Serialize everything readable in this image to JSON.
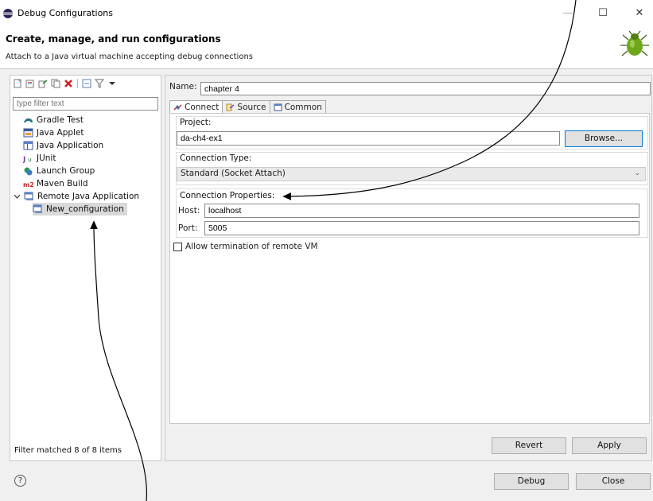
{
  "window": {
    "title": "Debug Configurations",
    "minimize_label": "—",
    "maximize_label": "☐",
    "close_label": "✕"
  },
  "header": {
    "title": "Create, manage, and run configurations",
    "subtitle": "Attach to a Java virtual machine accepting debug connections"
  },
  "left_panel": {
    "filter_placeholder": "type filter text",
    "tree": [
      {
        "label": "Gradle Test",
        "icon": "gradle-icon"
      },
      {
        "label": "Java Applet",
        "icon": "java-applet-icon"
      },
      {
        "label": "Java Application",
        "icon": "java-application-icon"
      },
      {
        "label": "JUnit",
        "icon": "junit-icon"
      },
      {
        "label": "Launch Group",
        "icon": "launch-group-icon"
      },
      {
        "label": "Maven Build",
        "icon": "maven-icon"
      },
      {
        "label": "Remote Java Application",
        "icon": "remote-java-icon",
        "expanded": true
      },
      {
        "label": "New_configuration",
        "icon": "remote-java-icon",
        "selected": true
      }
    ],
    "status": "Filter matched 8 of 8 items"
  },
  "config": {
    "name_label": "Name:",
    "name_value": "chapter 4",
    "tabs": [
      {
        "label": "Connect",
        "icon": "connect-icon",
        "active": true
      },
      {
        "label": "Source",
        "icon": "source-icon"
      },
      {
        "label": "Common",
        "icon": "common-icon"
      }
    ],
    "project_label": "Project:",
    "project_value": "da-ch4-ex1",
    "browse_label": "Browse...",
    "connection_type_label": "Connection Type:",
    "connection_type_value": "Standard (Socket Attach)",
    "connection_properties_label": "Connection Properties:",
    "host_label": "Host:",
    "host_value": "localhost",
    "port_label": "Port:",
    "port_value": "5005",
    "allow_termination_label": "Allow termination of remote VM",
    "allow_termination_checked": false,
    "revert_label": "Revert",
    "apply_label": "Apply"
  },
  "footer": {
    "help_label": "?",
    "debug_label": "Debug",
    "close_label": "Close"
  },
  "colors": {
    "window_bg": "#f0f0f0",
    "panel_bg": "#ffffff",
    "selection_bg": "#d9d9d9",
    "default_button_border": "#0078d7"
  }
}
